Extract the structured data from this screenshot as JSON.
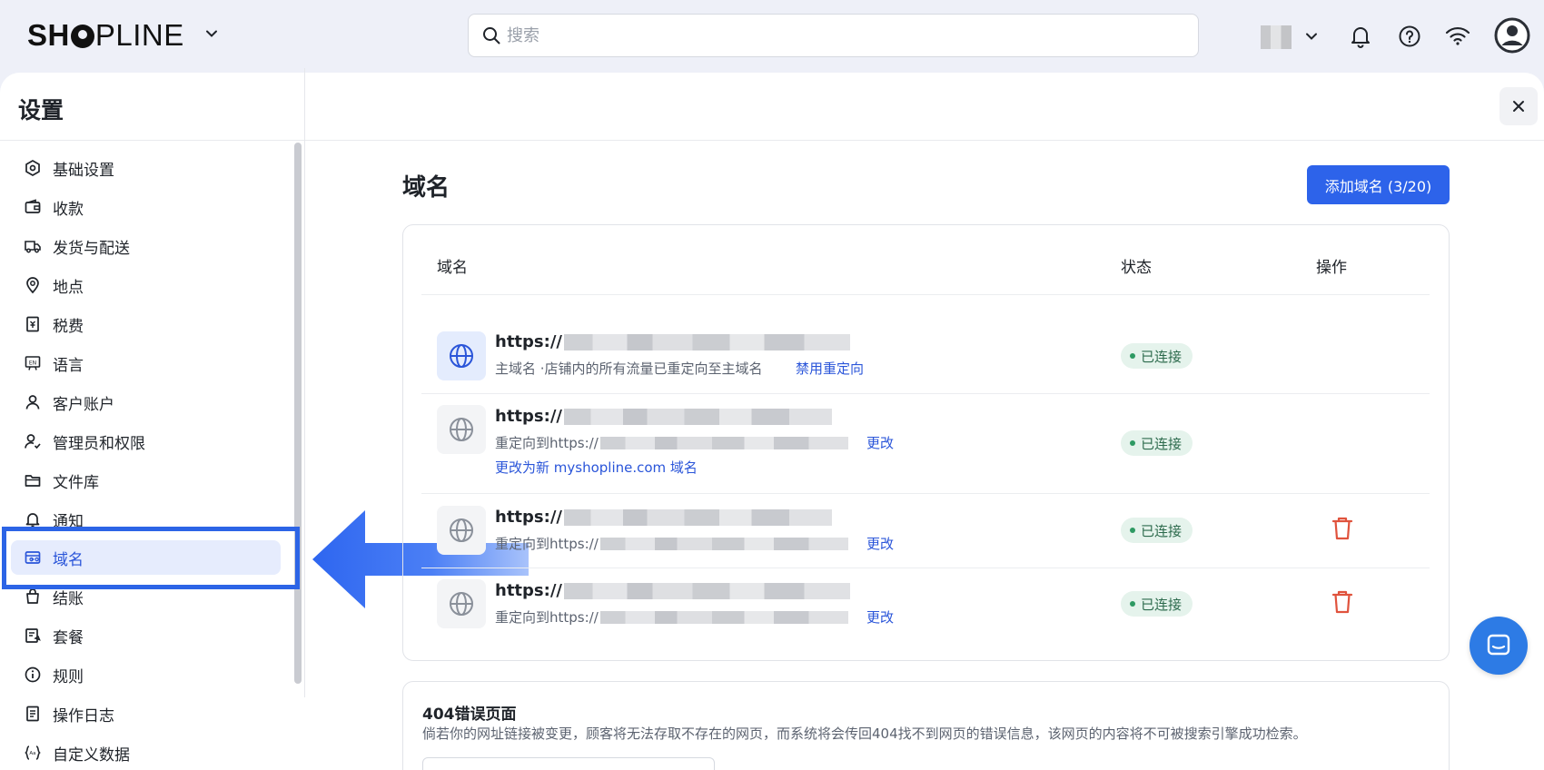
{
  "header": {
    "logo_bold": "SH",
    "logo_thin": "PLINE",
    "search_placeholder": "搜索"
  },
  "panel": {
    "title": "设置"
  },
  "sidebar": {
    "items": [
      {
        "label": "基础设置",
        "icon": "hexagon-settings-icon"
      },
      {
        "label": "收款",
        "icon": "wallet-icon"
      },
      {
        "label": "发货与配送",
        "icon": "truck-icon"
      },
      {
        "label": "地点",
        "icon": "location-pin-icon"
      },
      {
        "label": "税费",
        "icon": "receipt-icon"
      },
      {
        "label": "语言",
        "icon": "language-icon"
      },
      {
        "label": "客户账户",
        "icon": "user-icon"
      },
      {
        "label": "管理员和权限",
        "icon": "user-permission-icon"
      },
      {
        "label": "文件库",
        "icon": "folder-icon"
      },
      {
        "label": "通知",
        "icon": "bell-icon"
      },
      {
        "label": "域名",
        "icon": "domain-icon"
      },
      {
        "label": "结账",
        "icon": "checkout-icon"
      },
      {
        "label": "套餐",
        "icon": "plan-icon"
      },
      {
        "label": "规则",
        "icon": "info-icon"
      },
      {
        "label": "操作日志",
        "icon": "log-icon"
      },
      {
        "label": "自定义数据",
        "icon": "custom-data-icon"
      }
    ],
    "active": "域名"
  },
  "main": {
    "title": "域名",
    "add_button": "添加域名 (3/20)",
    "table": {
      "headers": [
        "域名",
        "状态",
        "操作"
      ],
      "rows": [
        {
          "url": "https://",
          "sub": "主域名 ·店铺内的所有流量已重定向至主域名",
          "action_link": "禁用重定向",
          "status": "已连接",
          "deletable": false
        },
        {
          "url": "https://",
          "sub": "重定向到https://",
          "action_link": "更改",
          "extra_link": "更改为新 myshopline.com 域名",
          "status": "已连接",
          "deletable": false
        },
        {
          "url": "https://",
          "sub": "重定向到https://",
          "action_link": "更改",
          "status": "已连接",
          "deletable": true
        },
        {
          "url": "https://",
          "sub": "重定向到https://",
          "action_link": "更改",
          "status": "已连接",
          "deletable": true
        }
      ]
    },
    "error_page": {
      "title": "404错误页面",
      "description": "倘若你的网址链接被变更，顾客将无法存取不存在的网页，而系统将会传回404找不到网页的错误信息，该网页的内容将不可被搜索引擎成功检索。"
    }
  },
  "colors": {
    "accent": "#2d63ea",
    "status_green": "#2e9a63",
    "danger": "#e0533d",
    "highlight": "#2c64e6"
  }
}
